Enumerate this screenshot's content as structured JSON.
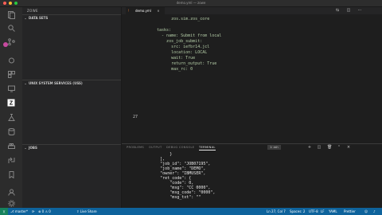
{
  "window": {
    "title": "demo.yml — zowe"
  },
  "sidebar": {
    "title": "ZOWE",
    "sections": [
      {
        "label": "DATA SETS"
      },
      {
        "label": "UNIX SYSTEM SERVICES (USS)"
      },
      {
        "label": "JOBS"
      }
    ]
  },
  "editor": {
    "tab": {
      "icon": "yaml-file-icon",
      "label": "demo.yml",
      "close": "×"
    },
    "lines": [
      {
        "n": "",
        "text": "        zos.sim.zos_core"
      },
      {
        "n": "",
        "text": ""
      },
      {
        "n": "",
        "text": "  tasks:"
      },
      {
        "n": "",
        "text": "    - name: Submit from local"
      },
      {
        "n": "",
        "text": "      zos_job_submit:"
      },
      {
        "n": "",
        "text": "        src: iefbr14.jcl"
      },
      {
        "n": "",
        "text": "        location: LOCAL"
      },
      {
        "n": "",
        "text": "        wait: True"
      },
      {
        "n": "",
        "text": "        return_output: True"
      },
      {
        "n": "",
        "text": "        max_rc: 0"
      },
      {
        "n": "",
        "text": ""
      },
      {
        "n": "",
        "text": ""
      },
      {
        "n": "",
        "text": ""
      },
      {
        "n": "",
        "text": ""
      },
      {
        "n": "",
        "text": ""
      },
      {
        "n": "",
        "text": ""
      },
      {
        "n": "",
        "text": ""
      },
      {
        "n": "27",
        "text": ""
      }
    ]
  },
  "panel": {
    "tabs": [
      "PROBLEMS",
      "OUTPUT",
      "DEBUG CONSOLE",
      "TERMINAL"
    ],
    "active_tab": "TERMINAL",
    "terminal_select": "1: zsh",
    "terminal": [
      "                    }",
      "                ],",
      "                \"job_id\": \"JOB07195\",",
      "                \"job_name\": \"DEMO\",",
      "                \"owner\": \"IBMUSER\",",
      "                \"ret_code\": {",
      "                    \"code\": 0,",
      "                    \"msg\": \"CC 0000\",",
      "                    \"msg_code\": \"0000\",",
      "                    \"msg_txt\": \"\""
    ]
  },
  "status": {
    "branch": "master*",
    "sync": "⟳",
    "problems": "⊗ 0 ⚠ 0",
    "live_share": "Live Share",
    "position": "Ln 27, Col 7",
    "spaces": "Spaces: 2",
    "encoding": "UTF-8",
    "eol": "LF",
    "language": "YAML",
    "formatter": "Prettier"
  },
  "colors": {
    "accent_status": "#0e639c",
    "code_text": "#b5cea8",
    "activity_badge": "#c74aa0"
  }
}
